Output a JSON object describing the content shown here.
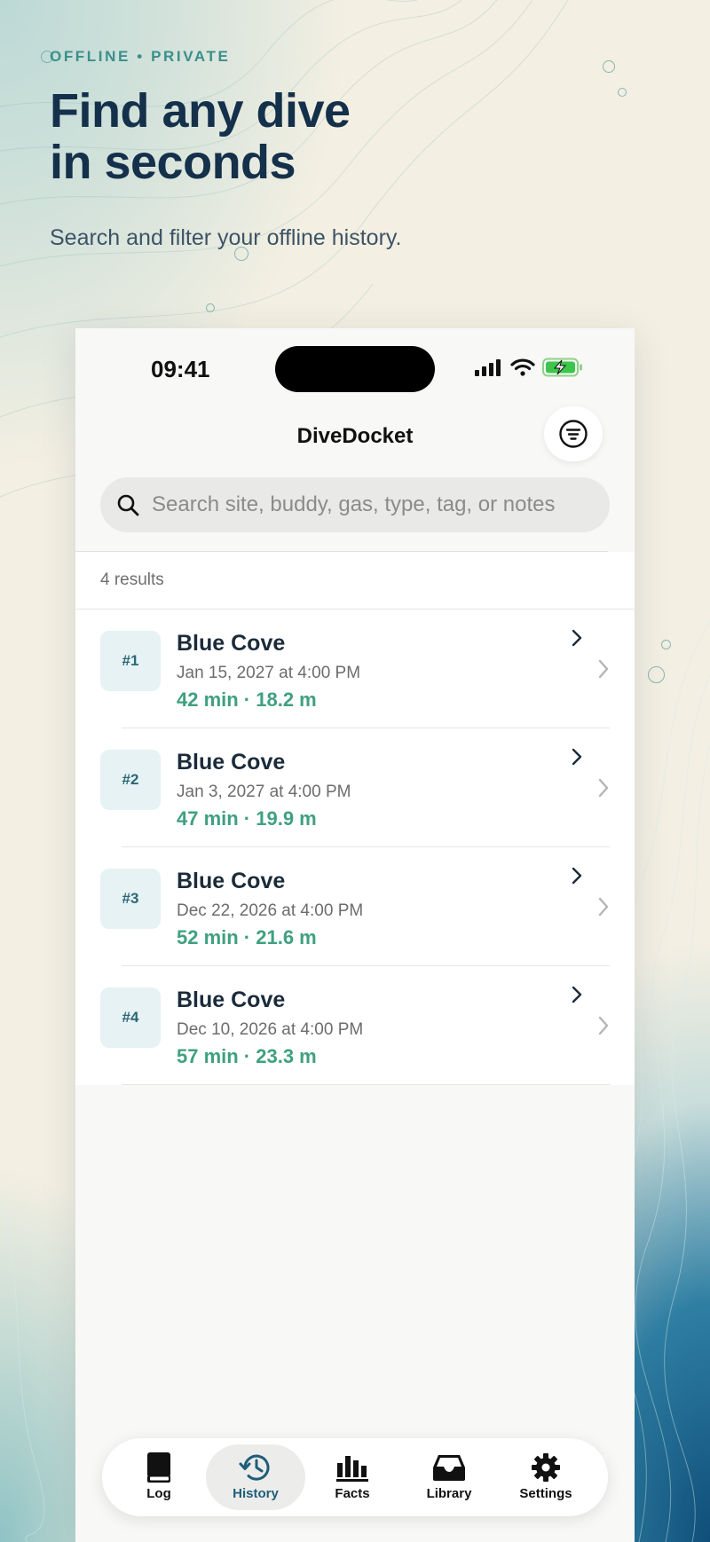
{
  "marketing": {
    "eyebrow": "OFFLINE • PRIVATE",
    "headline_line1": "Find any dive",
    "headline_line2": "in seconds",
    "subhead": "Search and filter your offline history."
  },
  "status_bar": {
    "time": "09:41"
  },
  "nav": {
    "title": "DiveDocket",
    "filter_icon": "filter-icon"
  },
  "search": {
    "placeholder": "Search site, buddy, gas, type, tag, or notes",
    "value": ""
  },
  "results": {
    "count_label": "4 results",
    "items": [
      {
        "badge": "#1",
        "site": "Blue Cove",
        "date": "Jan 15, 2027 at 4:00 PM",
        "stats": "42 min · 18.2 m"
      },
      {
        "badge": "#2",
        "site": "Blue Cove",
        "date": "Jan 3, 2027 at 4:00 PM",
        "stats": "47 min · 19.9 m"
      },
      {
        "badge": "#3",
        "site": "Blue Cove",
        "date": "Dec 22, 2026 at 4:00 PM",
        "stats": "52 min · 21.6 m"
      },
      {
        "badge": "#4",
        "site": "Blue Cove",
        "date": "Dec 10, 2026 at 4:00 PM",
        "stats": "57 min · 23.3 m"
      }
    ]
  },
  "tabs": [
    {
      "label": "Log",
      "icon": "book-icon"
    },
    {
      "label": "History",
      "icon": "history-icon",
      "active": true
    },
    {
      "label": "Facts",
      "icon": "bar-chart-icon"
    },
    {
      "label": "Library",
      "icon": "inbox-tray-icon"
    },
    {
      "label": "Settings",
      "icon": "gear-icon"
    }
  ],
  "colors": {
    "accent": "#3fa07f",
    "heading": "#14304a",
    "active_tab": "#1f5d7a"
  }
}
